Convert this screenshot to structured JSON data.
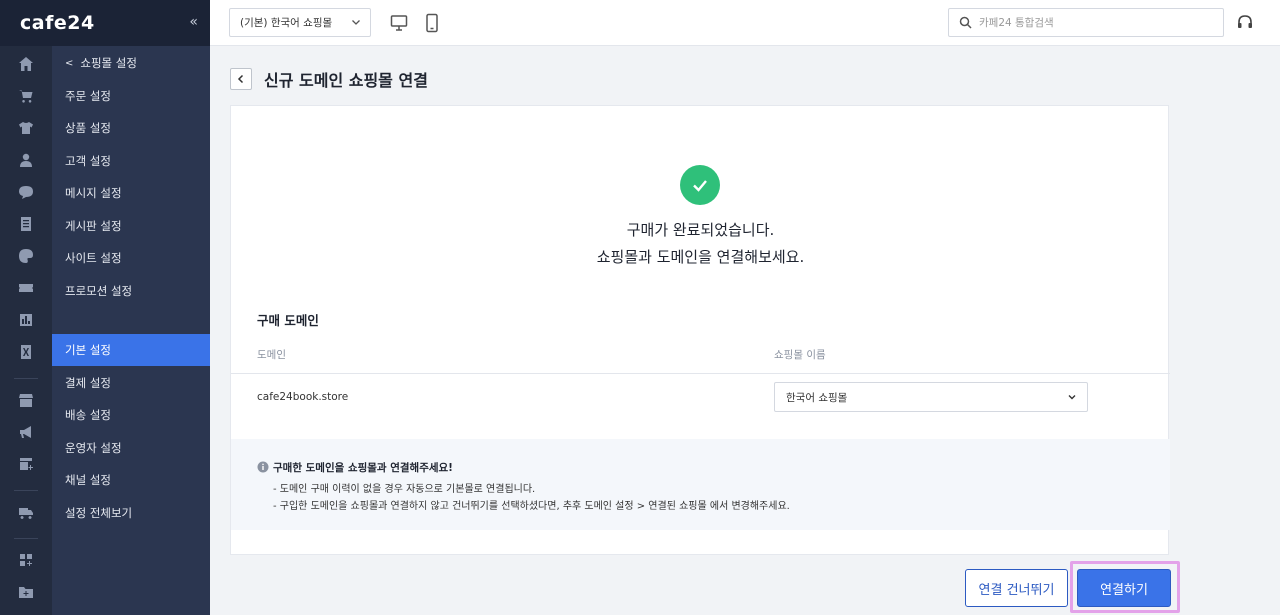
{
  "brand": {
    "logo_text": "cafe24"
  },
  "icons": {
    "collapse": "double-chevron-left-icon",
    "rail": [
      "home-icon",
      "cart-icon",
      "shirt-icon",
      "person-icon",
      "chat-icon",
      "board-icon",
      "palette-icon",
      "ticket-icon",
      "chart-icon",
      "file-excel-icon",
      "store-icon",
      "megaphone-icon",
      "shop-plus-icon",
      "truck-icon",
      "grid-plus-icon",
      "folder-plus-icon"
    ]
  },
  "header": {
    "mall_selector": "(기본) 한국어 쇼핑몰",
    "search_placeholder": "카페24 통합검색"
  },
  "subnav": {
    "back_label": "쇼핑몰 설정",
    "items": [
      {
        "label": "주문 설정"
      },
      {
        "label": "상품 설정"
      },
      {
        "label": "고객 설정"
      },
      {
        "label": "메시지 설정"
      },
      {
        "label": "게시판 설정"
      },
      {
        "label": "사이트 설정"
      },
      {
        "label": "프로모션 설정"
      },
      {
        "label": "기본 설정",
        "active": true
      },
      {
        "label": "결제 설정"
      },
      {
        "label": "배송 설정"
      },
      {
        "label": "운영자 설정"
      },
      {
        "label": "채널 설정"
      },
      {
        "label": "설정 전체보기"
      }
    ]
  },
  "page": {
    "title": "신규 도메인 쇼핑몰 연결",
    "done_line1": "구매가 완료되었습니다.",
    "done_line2": "쇼핑몰과 도메인을 연결해보세요.",
    "section_title": "구매 도메인",
    "col_domain": "도메인",
    "col_mall_name": "쇼핑몰 이름",
    "domain_value": "cafe24book.store",
    "mall_name_value": "한국어 쇼핑몰",
    "notice_title": "구매한 도메인을 쇼핑몰과 연결해주세요!",
    "notice_line1": "- 도메인 구매 이력이 없을 경우 자동으로 기본몰로 연결됩니다.",
    "notice_line2": "- 구입한 도메인을 쇼핑몰과 연결하지 않고 건너뛰기를 선택하셨다면, 추후 도메인 설정 > 연결된 쇼핑몰 에서 변경해주세요."
  },
  "buttons": {
    "skip": "연결 건너뛰기",
    "connect": "연결하기"
  },
  "colors": {
    "accent": "#3a73e8",
    "success": "#2fc07a",
    "sidebar_dark": "#232c3f",
    "sidebar": "#2b3650",
    "highlight_frame": "#e3a2e9"
  }
}
